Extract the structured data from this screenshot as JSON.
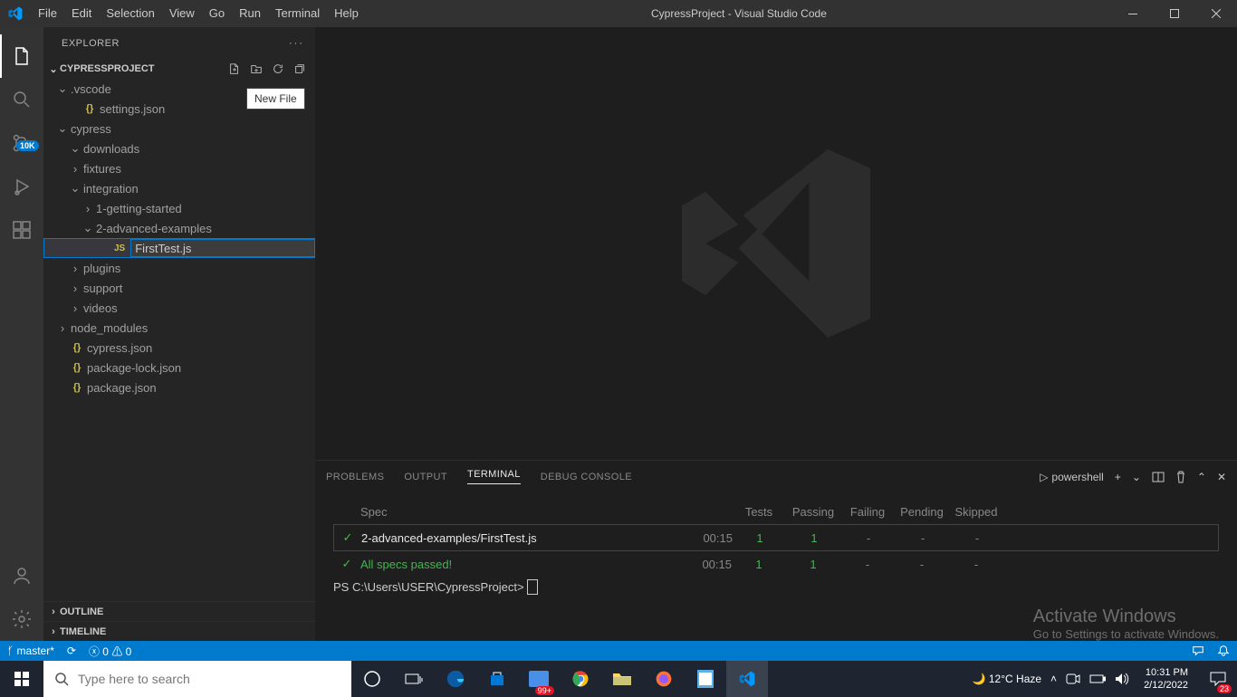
{
  "title": "CypressProject - Visual Studio Code",
  "menu": [
    "File",
    "Edit",
    "Selection",
    "View",
    "Go",
    "Run",
    "Terminal",
    "Help"
  ],
  "explorer": {
    "title": "EXPLORER",
    "project": "CYPRESSPROJECT",
    "tooltip_newfile": "New File",
    "bottom": {
      "outline": "OUTLINE",
      "timeline": "TIMELINE"
    }
  },
  "tree": {
    "vscode": ".vscode",
    "settings": "settings.json",
    "cypress": "cypress",
    "downloads": "downloads",
    "fixtures": "fixtures",
    "integration": "integration",
    "getting": "1-getting-started",
    "advanced": "2-advanced-examples",
    "rename_value": "FirstTest.js",
    "plugins": "plugins",
    "support": "support",
    "videos": "videos",
    "node_modules": "node_modules",
    "cypress_json": "cypress.json",
    "package_lock": "package-lock.json",
    "package_json": "package.json"
  },
  "panel": {
    "tabs": {
      "problems": "PROBLEMS",
      "output": "OUTPUT",
      "terminal": "TERMINAL",
      "debug": "DEBUG CONSOLE"
    },
    "shell": "powershell"
  },
  "terminal": {
    "headers": {
      "spec": "Spec",
      "tests": "Tests",
      "passing": "Passing",
      "failing": "Failing",
      "pending": "Pending",
      "skipped": "Skipped"
    },
    "row": {
      "name": "2-advanced-examples/FirstTest.js",
      "time": "00:15",
      "tests": "1",
      "passing": "1",
      "failing": "-",
      "pending": "-",
      "skipped": "-"
    },
    "summary": {
      "name": "All specs passed!",
      "time": "00:15",
      "tests": "1",
      "passing": "1",
      "failing": "-",
      "pending": "-",
      "skipped": "-"
    },
    "prompt": "PS C:\\Users\\USER\\CypressProject> "
  },
  "activate": {
    "title": "Activate Windows",
    "sub": "Go to Settings to activate Windows."
  },
  "status": {
    "branch": "master*",
    "sync": "",
    "errors": "0",
    "warnings": "0"
  },
  "activitybar": {
    "badge": "10K"
  },
  "taskbar": {
    "search_placeholder": "Type here to search",
    "weather": "12°C Haze",
    "time": "10:31 PM",
    "date": "2/12/2022",
    "notif_count": "23",
    "news_badge": "99+"
  }
}
